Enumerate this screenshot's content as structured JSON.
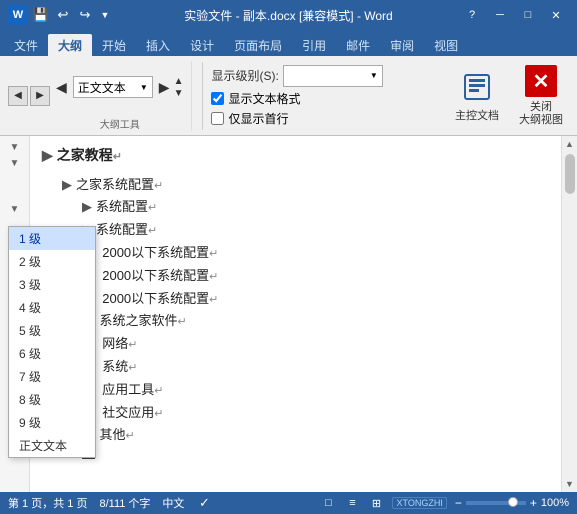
{
  "titlebar": {
    "title": "实验文件 - 副本.docx [兼容模式] - Word",
    "help_btn": "?",
    "min_btn": "─",
    "max_btn": "□",
    "close_btn": "✕"
  },
  "ribbon": {
    "tabs": [
      "文件",
      "大纲",
      "开始",
      "插入",
      "设计",
      "页面布局",
      "引用",
      "邮件",
      "审阅",
      "视图"
    ],
    "active_tab": "大纲",
    "outline_tools_label": "大纲工具",
    "close_group_label": "关闭",
    "outline_level_label": "正文文本",
    "show_level_label": "显示级别(S):",
    "show_text_format_label": "显示文本格式",
    "show_first_line_label": "仅显示首行",
    "master_doc_label": "主控文档",
    "close_outline_label": "关闭\n大纲视图"
  },
  "dropdown": {
    "items": [
      "1 级",
      "2 级",
      "3 级",
      "4 级",
      "5 级",
      "6 级",
      "7 级",
      "8 级",
      "9 级",
      "正文文本"
    ],
    "selected": "1 级"
  },
  "document": {
    "lines": [
      {
        "indent": 0,
        "bullet": "arrow",
        "text": "之家教程",
        "mark": "↵",
        "style": "h1"
      },
      {
        "indent": 1,
        "bullet": "arrow",
        "text": "之家系统配置",
        "mark": "↵",
        "style": "h2"
      },
      {
        "indent": 2,
        "bullet": "arrow",
        "text": "系统配置",
        "mark": "↵",
        "style": "h3"
      },
      {
        "indent": 2,
        "bullet": "arrow",
        "text": "系统配置",
        "mark": "↵",
        "style": "h3"
      },
      {
        "indent": 2,
        "bullet": "none",
        "text": "3、2000以下系统配置",
        "mark": "↵",
        "style": "body"
      },
      {
        "indent": 2,
        "bullet": "none",
        "text": "4、2000以下系统配置",
        "mark": "↵",
        "style": "body"
      },
      {
        "indent": 2,
        "bullet": "none",
        "text": "5、2000以下系统配置",
        "mark": "↵",
        "style": "body"
      },
      {
        "indent": 1,
        "bullet": "circle",
        "text": "三、    系统之家软件",
        "mark": "↵",
        "style": "h2"
      },
      {
        "indent": 2,
        "bullet": "none",
        "text": "1、网络",
        "mark": "↵",
        "style": "body"
      },
      {
        "indent": 2,
        "bullet": "none",
        "text": "2、系统",
        "mark": "↵",
        "style": "body"
      },
      {
        "indent": 2,
        "bullet": "none",
        "text": "3、应用工具",
        "mark": "↵",
        "style": "body"
      },
      {
        "indent": 2,
        "bullet": "none",
        "text": "4、社交应用",
        "mark": "↵",
        "style": "body"
      },
      {
        "indent": 1,
        "bullet": "circle",
        "text": "四、    其他",
        "mark": "↵",
        "style": "h2"
      },
      {
        "indent": 2,
        "bullet": "dash",
        "text": "",
        "mark": "",
        "style": "body"
      }
    ]
  },
  "statusbar": {
    "page_info": "第 1 页，共 1 页",
    "word_count": "8/111 个字",
    "lang": "中文",
    "zoom": "100%",
    "layout_icons": [
      "□",
      "≡",
      "⊞"
    ]
  },
  "colors": {
    "ribbon_bg": "#2c5f9e",
    "tab_active_bg": "#f0f0f0",
    "accent": "#4a80c0"
  }
}
